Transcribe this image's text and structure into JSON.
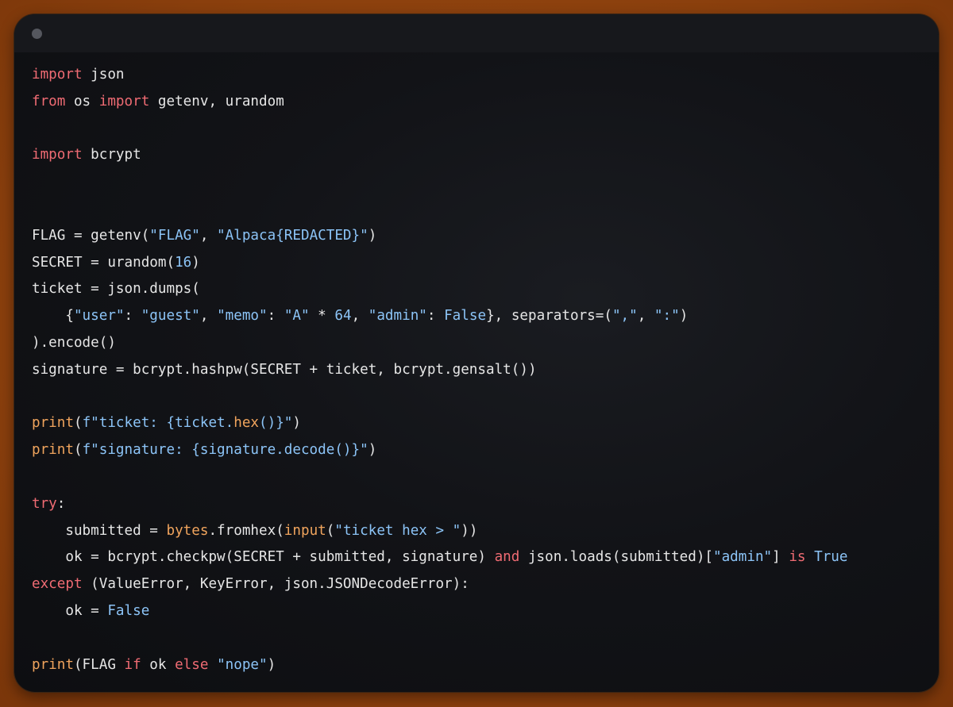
{
  "colors": {
    "background": "#94460f",
    "window": "#121317",
    "titlebar": "#17181c",
    "keyword": "#ef6b73",
    "string": "#8cc4f7",
    "builtin": "#f0a45d",
    "text": "#e6e6e6"
  },
  "window": {
    "control_icon": "window-dot-icon"
  },
  "code": {
    "lines": [
      [
        {
          "t": "import",
          "c": "kw"
        },
        {
          "t": " json",
          "c": "pl"
        }
      ],
      [
        {
          "t": "from",
          "c": "kw"
        },
        {
          "t": " os ",
          "c": "pl"
        },
        {
          "t": "import",
          "c": "kw"
        },
        {
          "t": " getenv, urandom",
          "c": "pl"
        }
      ],
      [],
      [
        {
          "t": "import",
          "c": "kw"
        },
        {
          "t": " bcrypt",
          "c": "pl"
        }
      ],
      [],
      [],
      [
        {
          "t": "FLAG = getenv(",
          "c": "pl"
        },
        {
          "t": "\"FLAG\"",
          "c": "str"
        },
        {
          "t": ", ",
          "c": "pl"
        },
        {
          "t": "\"Alpaca{REDACTED}\"",
          "c": "str"
        },
        {
          "t": ")",
          "c": "pl"
        }
      ],
      [
        {
          "t": "SECRET = urandom(",
          "c": "pl"
        },
        {
          "t": "16",
          "c": "num"
        },
        {
          "t": ")",
          "c": "pl"
        }
      ],
      [
        {
          "t": "ticket = json.dumps(",
          "c": "pl"
        }
      ],
      [
        {
          "t": "    ",
          "c": "pl"
        },
        {
          "t": "{",
          "c": "pl"
        },
        {
          "t": "\"user\"",
          "c": "str"
        },
        {
          "t": ": ",
          "c": "pl"
        },
        {
          "t": "\"guest\"",
          "c": "str"
        },
        {
          "t": ", ",
          "c": "pl"
        },
        {
          "t": "\"memo\"",
          "c": "str"
        },
        {
          "t": ": ",
          "c": "pl"
        },
        {
          "t": "\"A\"",
          "c": "str"
        },
        {
          "t": " * ",
          "c": "pl"
        },
        {
          "t": "64",
          "c": "num"
        },
        {
          "t": ", ",
          "c": "pl"
        },
        {
          "t": "\"admin\"",
          "c": "str"
        },
        {
          "t": ": ",
          "c": "pl"
        },
        {
          "t": "False",
          "c": "num"
        },
        {
          "t": "}, separators=(",
          "c": "pl"
        },
        {
          "t": "\",\"",
          "c": "str"
        },
        {
          "t": ", ",
          "c": "pl"
        },
        {
          "t": "\":\"",
          "c": "str"
        },
        {
          "t": ")",
          "c": "pl"
        }
      ],
      [
        {
          "t": ").encode()",
          "c": "pl"
        }
      ],
      [
        {
          "t": "signature = bcrypt.hashpw(SECRET + ticket, bcrypt.gensalt())",
          "c": "pl"
        }
      ],
      [],
      [
        {
          "t": "print",
          "c": "fn"
        },
        {
          "t": "(",
          "c": "pl"
        },
        {
          "t": "f\"ticket: ",
          "c": "str"
        },
        {
          "t": "{ticket.",
          "c": "str"
        },
        {
          "t": "hex",
          "c": "fn"
        },
        {
          "t": "()}\"",
          "c": "str"
        },
        {
          "t": ")",
          "c": "pl"
        }
      ],
      [
        {
          "t": "print",
          "c": "fn"
        },
        {
          "t": "(",
          "c": "pl"
        },
        {
          "t": "f\"signature: {signature.decode()}\"",
          "c": "str"
        },
        {
          "t": ")",
          "c": "pl"
        }
      ],
      [],
      [
        {
          "t": "try",
          "c": "kw"
        },
        {
          "t": ":",
          "c": "pl"
        }
      ],
      [
        {
          "t": "    ",
          "c": "pl"
        },
        {
          "t": "submitted = ",
          "c": "pl"
        },
        {
          "t": "bytes",
          "c": "fn"
        },
        {
          "t": ".fromhex(",
          "c": "pl"
        },
        {
          "t": "input",
          "c": "fn"
        },
        {
          "t": "(",
          "c": "pl"
        },
        {
          "t": "\"ticket hex > \"",
          "c": "str"
        },
        {
          "t": "))",
          "c": "pl"
        }
      ],
      [
        {
          "t": "    ",
          "c": "pl"
        },
        {
          "t": "ok = bcrypt.checkpw(SECRET + submitted, signature) ",
          "c": "pl"
        },
        {
          "t": "and",
          "c": "kw"
        },
        {
          "t": " json.loads(submitted)[",
          "c": "pl"
        },
        {
          "t": "\"admin\"",
          "c": "str"
        },
        {
          "t": "] ",
          "c": "pl"
        },
        {
          "t": "is",
          "c": "kw"
        },
        {
          "t": " ",
          "c": "pl"
        },
        {
          "t": "True",
          "c": "num"
        }
      ],
      [
        {
          "t": "except",
          "c": "kw"
        },
        {
          "t": " (ValueError, KeyError, json.JSONDecodeError):",
          "c": "pl"
        }
      ],
      [
        {
          "t": "    ",
          "c": "pl"
        },
        {
          "t": "ok = ",
          "c": "pl"
        },
        {
          "t": "False",
          "c": "num"
        }
      ],
      [],
      [
        {
          "t": "print",
          "c": "fn"
        },
        {
          "t": "(FLAG ",
          "c": "pl"
        },
        {
          "t": "if",
          "c": "kw"
        },
        {
          "t": " ok ",
          "c": "pl"
        },
        {
          "t": "else",
          "c": "kw"
        },
        {
          "t": " ",
          "c": "pl"
        },
        {
          "t": "\"nope\"",
          "c": "str"
        },
        {
          "t": ")",
          "c": "pl"
        }
      ]
    ]
  }
}
